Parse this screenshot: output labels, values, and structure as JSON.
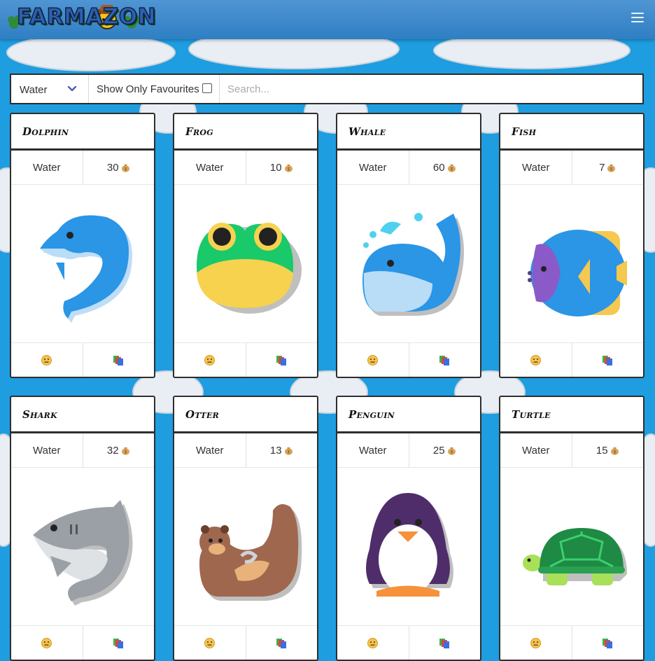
{
  "app": {
    "logo_text": "FARMAZON"
  },
  "filters": {
    "category_selected": "Water",
    "favourites_label": "Show Only Favourites",
    "favourites_checked": false,
    "search_placeholder": "Search..."
  },
  "animals": [
    {
      "name": "Dolphin",
      "habitat": "Water",
      "price": "30"
    },
    {
      "name": "Frog",
      "habitat": "Water",
      "price": "10"
    },
    {
      "name": "Whale",
      "habitat": "Water",
      "price": "60"
    },
    {
      "name": "Fish",
      "habitat": "Water",
      "price": "7"
    },
    {
      "name": "Shark",
      "habitat": "Water",
      "price": "32"
    },
    {
      "name": "Otter",
      "habitat": "Water",
      "price": "13"
    },
    {
      "name": "Penguin",
      "habitat": "Water",
      "price": "25"
    },
    {
      "name": "Turtle",
      "habitat": "Water",
      "price": "15"
    }
  ],
  "icons": {
    "price": "money-bag-icon",
    "favourite": "neutral-face-icon",
    "compare": "cards-stack-icon",
    "menu": "hamburger-icon"
  },
  "colors": {
    "background": "#1e9de0",
    "navbar": "#3d88cb",
    "card_border": "#2e2e2e"
  }
}
